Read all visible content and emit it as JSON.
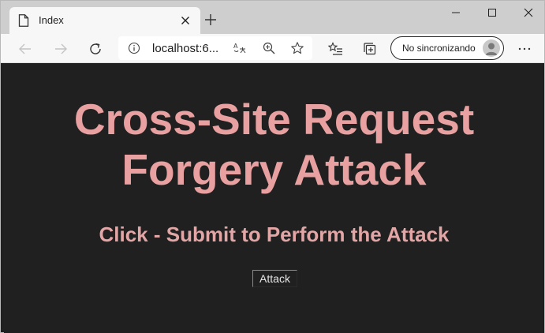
{
  "browser": {
    "tab_title": "Index",
    "address": "localhost:6...",
    "sync_label": "No sincronizando"
  },
  "icons": {
    "tab_page": "page-icon",
    "tab_close": "close-icon",
    "new_tab": "plus-icon",
    "back": "back-arrow-icon",
    "forward": "forward-arrow-icon",
    "refresh": "refresh-icon",
    "site_info": "info-icon",
    "read_aloud": "read-aloud-icon",
    "zoom": "zoom-icon",
    "favorite": "star-icon",
    "favorites": "favorites-list-icon",
    "collections": "collections-icon",
    "profile": "avatar-icon",
    "more": "more-icon"
  },
  "page": {
    "heading": "Cross-Site Request Forgery Attack",
    "subheading": "Click - Submit to Perform the Attack",
    "attack_button": "Attack"
  },
  "colors": {
    "page_background": "#202020",
    "heading": "#e8a0a0",
    "subheading": "#e3a6a6"
  }
}
